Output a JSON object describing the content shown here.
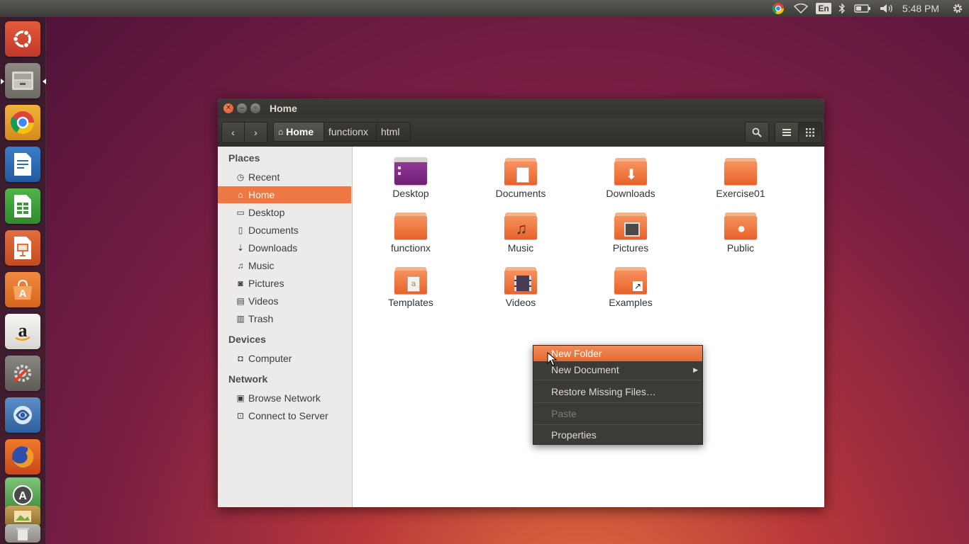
{
  "top_panel": {
    "keyboard_layout": "En",
    "clock": "5:48 PM",
    "tray_icons": [
      "chrome-icon",
      "wifi-icon",
      "keyboard-layout-indicator",
      "bluetooth-icon",
      "battery-icon",
      "volume-icon",
      "gear-icon"
    ]
  },
  "launcher": {
    "items": [
      "ubuntu-logo-icon",
      "files-icon",
      "chrome-icon",
      "writer-icon",
      "calc-icon",
      "impress-icon",
      "software-center-icon",
      "amazon-icon",
      "system-settings-icon",
      "app-icon",
      "firefox-icon",
      "software-updater-icon",
      "image-viewer-icon",
      "trash-icon"
    ]
  },
  "window": {
    "title": "Home",
    "breadcrumbs": [
      "Home",
      "functionx",
      "html"
    ]
  },
  "sidebar": {
    "sections": [
      {
        "title": "Places",
        "items": [
          {
            "label": "Recent",
            "icon": "clock-icon"
          },
          {
            "label": "Home",
            "icon": "home-icon",
            "active": true
          },
          {
            "label": "Desktop",
            "icon": "desktop-icon"
          },
          {
            "label": "Documents",
            "icon": "document-icon"
          },
          {
            "label": "Downloads",
            "icon": "download-icon"
          },
          {
            "label": "Music",
            "icon": "music-icon"
          },
          {
            "label": "Pictures",
            "icon": "camera-icon"
          },
          {
            "label": "Videos",
            "icon": "film-icon"
          },
          {
            "label": "Trash",
            "icon": "trash-icon"
          }
        ]
      },
      {
        "title": "Devices",
        "items": [
          {
            "label": "Computer",
            "icon": "drive-icon"
          }
        ]
      },
      {
        "title": "Network",
        "items": [
          {
            "label": "Browse Network",
            "icon": "network-icon"
          },
          {
            "label": "Connect to Server",
            "icon": "server-icon"
          }
        ]
      }
    ]
  },
  "files": [
    {
      "name": "Desktop",
      "icon": "desktop-folder-icon"
    },
    {
      "name": "Documents",
      "icon": "documents-folder-icon"
    },
    {
      "name": "Downloads",
      "icon": "downloads-folder-icon"
    },
    {
      "name": "Exercise01",
      "icon": "folder-icon"
    },
    {
      "name": "functionx",
      "icon": "folder-icon"
    },
    {
      "name": "Music",
      "icon": "music-folder-icon"
    },
    {
      "name": "Pictures",
      "icon": "pictures-folder-icon"
    },
    {
      "name": "Public",
      "icon": "public-folder-icon"
    },
    {
      "name": "Templates",
      "icon": "templates-folder-icon"
    },
    {
      "name": "Videos",
      "icon": "videos-folder-icon"
    },
    {
      "name": "Examples",
      "icon": "examples-folder-icon"
    }
  ],
  "context_menu": {
    "items": [
      {
        "label": "New Folder",
        "state": "highlighted"
      },
      {
        "label": "New Document",
        "has_submenu": true
      },
      {
        "label": "Restore Missing Files…"
      },
      {
        "label": "Paste",
        "state": "disabled"
      },
      {
        "label": "Properties"
      }
    ]
  },
  "colors": {
    "accent": "#ee7743",
    "panel": "#3c3b37",
    "folder": "#f07a45"
  }
}
